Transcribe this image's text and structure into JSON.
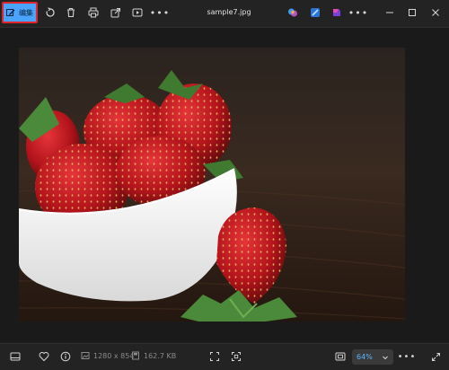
{
  "toolbar": {
    "edit_label": "编集",
    "file_title": "sample7.jpg"
  },
  "status": {
    "dimensions": "1280 x 854",
    "file_size": "162.7 KB",
    "zoom": "64%"
  },
  "icons": {
    "edit": "edit-image-icon",
    "rotate": "rotate-icon",
    "delete": "trash-icon",
    "print": "print-icon",
    "share": "share-icon",
    "slideshow": "slideshow-icon",
    "more": "more-icon",
    "copilot": "copilot-icon",
    "designer": "designer-icon",
    "clipchamp": "clipchamp-icon",
    "minimize": "minimize-icon",
    "maximize": "maximize-icon",
    "close": "close-icon"
  },
  "colors": {
    "accent": "#4aa3ff",
    "highlight_border": "#e0262b",
    "background": "#1f1f1f"
  }
}
